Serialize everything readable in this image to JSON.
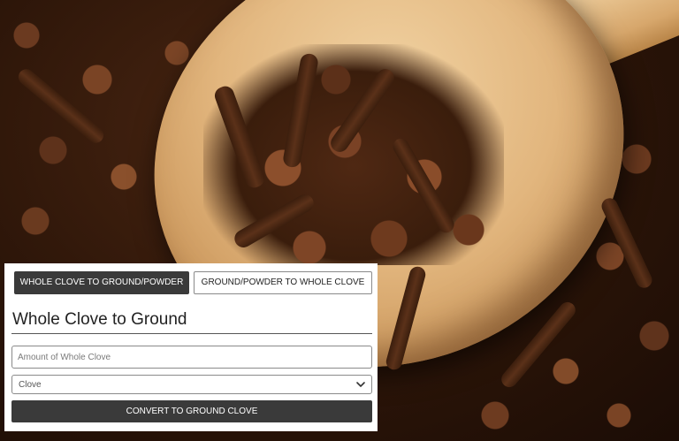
{
  "converter": {
    "tabs": [
      {
        "label": "WHOLE CLOVE TO GROUND/POWDER",
        "active": true
      },
      {
        "label": "GROUND/POWDER TO WHOLE CLOVE",
        "active": false
      }
    ],
    "title": "Whole Clove to Ground",
    "amount_input": {
      "value": "",
      "placeholder": "Amount of Whole Clove"
    },
    "unit_select": {
      "selected": "Clove"
    },
    "convert_button_label": "CONVERT TO GROUND CLOVE"
  },
  "icons": {
    "dropdown": "chevron-down-icon"
  },
  "colors": {
    "button_dark": "#3a3a3a",
    "button_text": "#ffffff",
    "border": "#8a8a8a",
    "panel_background": "#ffffff"
  }
}
